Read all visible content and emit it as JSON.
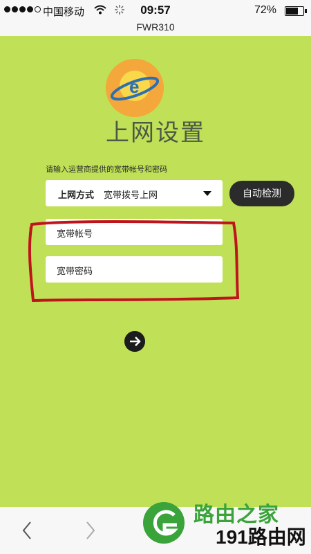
{
  "status_bar": {
    "carrier": "中国移动",
    "time": "09:57",
    "battery": "72%",
    "battery_level": 0.72
  },
  "browser": {
    "url": "FWR310"
  },
  "page": {
    "title": "上网设置",
    "instruction": "请输入运营商提供的宽带帐号和密码",
    "connection_type_label": "上网方式",
    "connection_type_value": "宽带拨号上网",
    "auto_detect_label": "自动检测",
    "account_placeholder": "宽带帐号",
    "password_placeholder": "宽带密码"
  },
  "watermark": {
    "site_name": "路由之家",
    "site_sub": "191路由网"
  },
  "colors": {
    "background": "#bfe057",
    "annotation": "#c0141c",
    "button": "#2b2b2b"
  },
  "icons": [
    "wifi-icon",
    "loading-icon",
    "battery-icon",
    "logo-icon",
    "dropdown-arrow-icon",
    "next-arrow-icon",
    "back-icon",
    "forward-icon",
    "menu-icon"
  ]
}
